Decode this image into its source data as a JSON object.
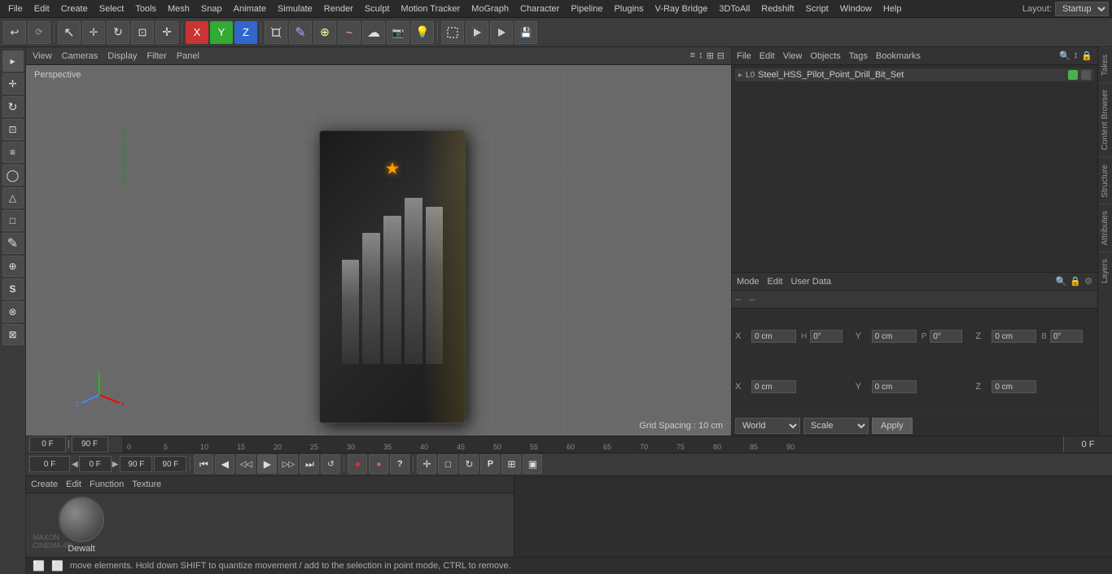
{
  "app": {
    "title": "Cinema 4D"
  },
  "menu": {
    "items": [
      "File",
      "Edit",
      "Create",
      "Select",
      "Tools",
      "Mesh",
      "Snap",
      "Animate",
      "Simulate",
      "Render",
      "Sculpt",
      "Motion Tracker",
      "MoGraph",
      "Character",
      "Pipeline",
      "Plugins",
      "V-Ray Bridge",
      "3DToAll",
      "Redshift",
      "Script",
      "Window",
      "Help"
    ],
    "layout_label": "Layout:",
    "layout_value": "Startup"
  },
  "toolbar": {
    "undo_btn": "↩",
    "redo_btn": "↪",
    "move_tool": "✛",
    "scale_tool": "⊠",
    "rotate_tool": "↻",
    "transform_tool": "+",
    "x_axis": "X",
    "y_axis": "Y",
    "z_axis": "Z",
    "render_region": "▣",
    "render_view": "▷",
    "render": "▶",
    "save_render": "💾"
  },
  "viewport": {
    "header_items": [
      "View",
      "Cameras",
      "Display",
      "Filter",
      "Panel"
    ],
    "perspective_label": "Perspective",
    "grid_spacing": "Grid Spacing : 10 cm",
    "header_icons": [
      "≡",
      "↕",
      "⊞",
      "⊟"
    ]
  },
  "left_sidebar": {
    "tools": [
      "▸",
      "✛",
      "↻",
      "⊡",
      "⊞",
      "◯",
      "△",
      "□",
      "✎",
      "⊕",
      "S",
      "⊗",
      "⊠"
    ]
  },
  "object_manager": {
    "header_items": [
      "File",
      "Edit",
      "View",
      "Objects",
      "Tags",
      "Bookmarks"
    ],
    "object_name": "Steel_HSS_Pilot_Point_Drill_Bit_Set",
    "search_icons": [
      "🔍",
      "↕",
      "🔒"
    ]
  },
  "attributes_panel": {
    "header_items": [
      "Mode",
      "Edit",
      "User Data"
    ],
    "sep1": "--",
    "sep2": "--",
    "position": {
      "x_label": "X",
      "x_value": "0 cm",
      "y_label": "Y",
      "y_value": "0 cm",
      "z_label": "Z",
      "z_value": "0 cm"
    },
    "rotation": {
      "h_label": "H",
      "h_value": "0°",
      "p_label": "P",
      "p_value": "0°",
      "b_label": "B",
      "b_value": "0°"
    },
    "scale": {
      "x_label": "X",
      "x_value": "0 cm",
      "y_label": "Y",
      "y_value": "0 cm",
      "z_label": "Z",
      "z_value": "0 cm"
    },
    "world_label": "World",
    "scale_label": "Scale",
    "apply_label": "Apply"
  },
  "timeline": {
    "current_frame": "0 F",
    "start_frame": "0 F",
    "end_preview": "90 F",
    "end_total": "90 F",
    "ruler_marks": [
      "0",
      "5",
      "10",
      "15",
      "20",
      "25",
      "30",
      "35",
      "40",
      "45",
      "50",
      "55",
      "60",
      "65",
      "70",
      "75",
      "80",
      "85",
      "90"
    ]
  },
  "transport": {
    "first_btn": "⏮",
    "prev_btn": "⏪",
    "play_btn": "▶",
    "next_btn": "⏩",
    "last_btn": "⏭",
    "loop_btn": "🔁",
    "record_btn": "⏺",
    "help_btn": "?",
    "extra_btns": [
      "+",
      "□",
      "↻",
      "P",
      "⊞",
      "▣"
    ]
  },
  "material_panel": {
    "header_items": [
      "Create",
      "Edit",
      "Function",
      "Texture"
    ],
    "material_name": "Dewalt"
  },
  "right_tabs": [
    "Takes",
    "Content Browser",
    "Structure",
    "Attributes",
    "Layers"
  ],
  "status_bar": {
    "message": "move elements. Hold down SHIFT to quantize movement / add to the selection in point mode, CTRL to remove.",
    "icons": [
      "⬜",
      "⬜"
    ]
  },
  "cinemap4d_logo": {
    "line1": "MAXON",
    "line2": "CINEMA 4D"
  }
}
